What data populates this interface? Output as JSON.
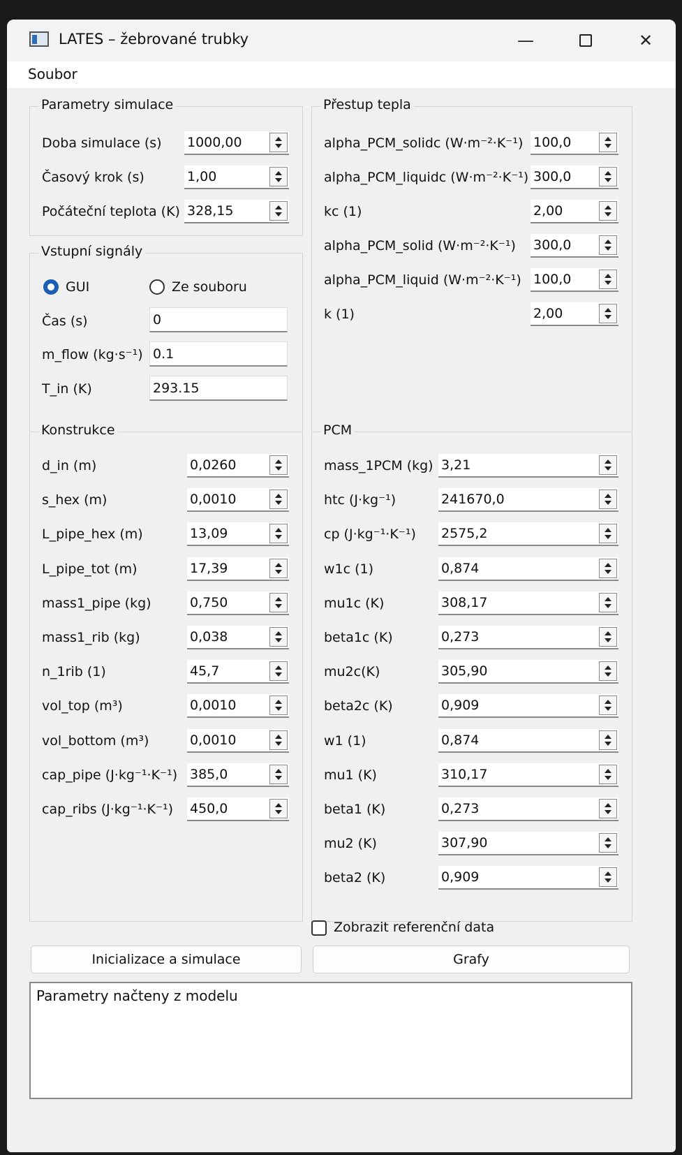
{
  "window": {
    "title": "LATES – žebrované trubky",
    "minimize_glyph": "—",
    "close_glyph": "✕"
  },
  "menu": {
    "file": "Soubor"
  },
  "sim_params": {
    "title": "Parametry simulace",
    "rows": [
      {
        "label": "Doba simulace (s)",
        "value": "1000,00"
      },
      {
        "label": "Časový krok (s)",
        "value": "1,00"
      },
      {
        "label": "Počáteční teplota (K)",
        "value": "328,15"
      }
    ]
  },
  "heat_transfer": {
    "title": "Přestup tepla",
    "rows": [
      {
        "label": "alpha_PCM_solidc (W·m⁻²·K⁻¹)",
        "value": "100,0"
      },
      {
        "label": "alpha_PCM_liquidc (W·m⁻²·K⁻¹)",
        "value": "300,0"
      },
      {
        "label": "kc (1)",
        "value": "2,00"
      },
      {
        "label": "alpha_PCM_solid (W·m⁻²·K⁻¹)",
        "value": "300,0"
      },
      {
        "label": "alpha_PCM_liquid (W·m⁻²·K⁻¹)",
        "value": "100,0"
      },
      {
        "label": "k (1)",
        "value": "2,00"
      }
    ]
  },
  "inputs": {
    "title": "Vstupní signály",
    "radio_gui": "GUI",
    "radio_file": "Ze souboru",
    "selected": "GUI",
    "rows": [
      {
        "label": "Čas (s)",
        "value": "0"
      },
      {
        "label": "m_flow (kg·s⁻¹)",
        "value": "0.1"
      },
      {
        "label": "T_in (K)",
        "value": "293.15"
      }
    ]
  },
  "construction": {
    "title": "Konstrukce",
    "rows": [
      {
        "label": "d_in (m)",
        "value": "0,0260"
      },
      {
        "label": "s_hex (m)",
        "value": "0,0010"
      },
      {
        "label": "L_pipe_hex (m)",
        "value": "13,09"
      },
      {
        "label": "L_pipe_tot (m)",
        "value": "17,39"
      },
      {
        "label": "mass1_pipe (kg)",
        "value": "0,750"
      },
      {
        "label": "mass1_rib (kg)",
        "value": "0,038"
      },
      {
        "label": "n_1rib (1)",
        "value": "45,7"
      },
      {
        "label": "vol_top (m³)",
        "value": "0,0010"
      },
      {
        "label": "vol_bottom (m³)",
        "value": "0,0010"
      },
      {
        "label": "cap_pipe (J·kg⁻¹·K⁻¹)",
        "value": "385,0"
      },
      {
        "label": "cap_ribs (J·kg⁻¹·K⁻¹)",
        "value": "450,0"
      }
    ]
  },
  "pcm": {
    "title": "PCM",
    "rows": [
      {
        "label": "mass_1PCM (kg)",
        "value": "3,21"
      },
      {
        "label": "htc (J·kg⁻¹)",
        "value": "241670,0"
      },
      {
        "label": "cp (J·kg⁻¹·K⁻¹)",
        "value": "2575,2"
      },
      {
        "label": "w1c (1)",
        "value": "0,874"
      },
      {
        "label": "mu1c (K)",
        "value": "308,17"
      },
      {
        "label": "beta1c (K)",
        "value": "0,273"
      },
      {
        "label": "mu2c(K)",
        "value": "305,90"
      },
      {
        "label": "beta2c (K)",
        "value": "0,909"
      },
      {
        "label": "w1 (1)",
        "value": "0,874"
      },
      {
        "label": "mu1 (K)",
        "value": "310,17"
      },
      {
        "label": "beta1 (K)",
        "value": "0,273"
      },
      {
        "label": "mu2 (K)",
        "value": "307,90"
      },
      {
        "label": "beta2 (K)",
        "value": "0,909"
      }
    ]
  },
  "reference_checkbox": "Zobrazit referenční data",
  "buttons": {
    "simulate": "Inicializace a simulace",
    "graphs": "Grafy"
  },
  "log": {
    "text": "Parametry načteny z modelu"
  }
}
